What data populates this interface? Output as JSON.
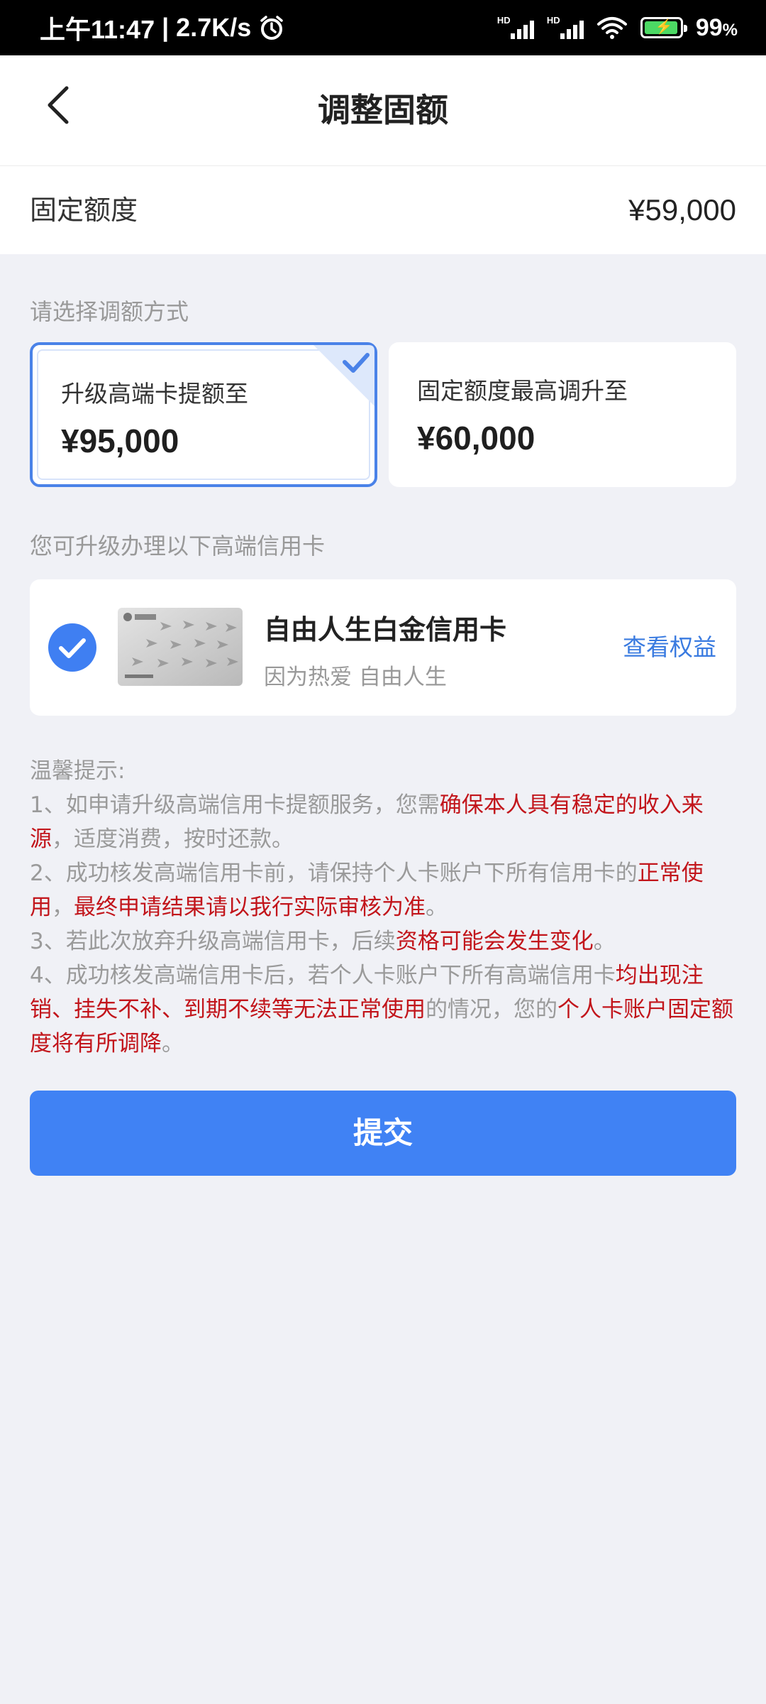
{
  "status_bar": {
    "time": "上午11:47",
    "net_speed": "2.7K/s",
    "battery": "99",
    "battery_unit": "%",
    "signal_1_label": "HD",
    "signal_2_label": "HD",
    "icons": [
      "alarm-icon",
      "signal-icon",
      "signal-icon",
      "wifi-icon",
      "battery-charging-icon"
    ]
  },
  "header": {
    "title": "调整固额",
    "back_icon": "chevron-left-icon"
  },
  "fixed_limit": {
    "label": "固定额度",
    "value": "¥59,000"
  },
  "method_section": {
    "label": "请选择调额方式",
    "options": [
      {
        "title": "升级高端卡提额至",
        "amount": "¥95,000",
        "selected": true
      },
      {
        "title": "固定额度最高调升至",
        "amount": "¥60,000",
        "selected": false
      }
    ]
  },
  "card_section": {
    "label": "您可升级办理以下高端信用卡",
    "card": {
      "name": "自由人生白金信用卡",
      "slogan": "因为热爱 自由人生",
      "link": "查看权益",
      "selected": true
    }
  },
  "tips": {
    "title": "温馨提示:",
    "items": [
      [
        {
          "t": "1、如申请升级高端信用卡提额服务，您需",
          "red": false
        },
        {
          "t": "确保本人具有稳定的收入来源",
          "red": true
        },
        {
          "t": "，适度消费，按时还款。",
          "red": false
        }
      ],
      [
        {
          "t": "2、成功核发高端信用卡前，请保持个人卡账户下所有信用卡的",
          "red": false
        },
        {
          "t": "正常使用",
          "red": true
        },
        {
          "t": "，",
          "red": false
        },
        {
          "t": "最终申请结果请以我行实际审核为准",
          "red": true
        },
        {
          "t": "。",
          "red": false
        }
      ],
      [
        {
          "t": "3、若此次放弃升级高端信用卡，后续",
          "red": false
        },
        {
          "t": "资格可能会发生变化",
          "red": true
        },
        {
          "t": "。",
          "red": false
        }
      ],
      [
        {
          "t": "4、成功核发高端信用卡后，若个人卡账户下所有高端信用卡",
          "red": false
        },
        {
          "t": "均出现注销、挂失不补、到期不续等无法正常使用",
          "red": true
        },
        {
          "t": "的情况，您的",
          "red": false
        },
        {
          "t": "个人卡账户固定额度将有所调降",
          "red": true
        },
        {
          "t": "。",
          "red": false
        }
      ]
    ]
  },
  "submit": {
    "label": "提交"
  },
  "colors": {
    "accent": "#4082f4",
    "warning_red": "#c2151b",
    "link_blue": "#3a7be0",
    "background": "#f0f1f6"
  }
}
